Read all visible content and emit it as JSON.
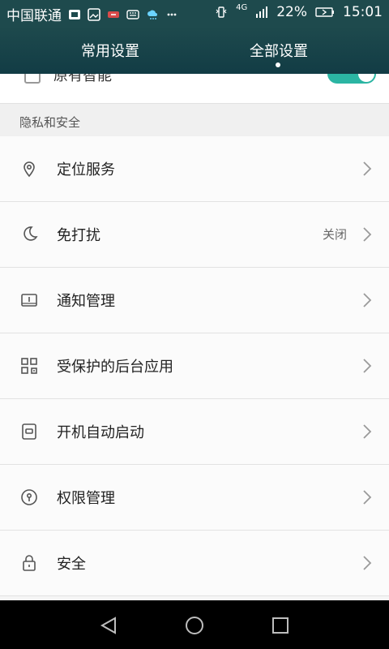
{
  "status_bar": {
    "carrier": "中国联通",
    "icons": [
      "chip-icon",
      "image-icon",
      "mobile-data-icon",
      "keyboard-icon",
      "cloud-rain-icon",
      "more-dots-icon"
    ],
    "right_icons": [
      "vibrate-icon",
      "signal-4g-icon",
      "battery-icon"
    ],
    "network": "4G",
    "battery": "22%",
    "time": "15:01"
  },
  "tabs": {
    "common": "常用设置",
    "all": "全部设置",
    "active": "all"
  },
  "partial_row": {
    "label": "原有智能",
    "toggle_on": true
  },
  "section": {
    "title": "隐私和安全"
  },
  "items": [
    {
      "label": "定位服务",
      "value": "",
      "icon": "location-pin-icon"
    },
    {
      "label": "免打扰",
      "value": "关闭",
      "icon": "moon-icon"
    },
    {
      "label": "通知管理",
      "value": "",
      "icon": "notification-box-icon"
    },
    {
      "label": "受保护的后台应用",
      "value": "",
      "icon": "protected-apps-icon"
    },
    {
      "label": "开机自动启动",
      "value": "",
      "icon": "startup-icon"
    },
    {
      "label": "权限管理",
      "value": "",
      "icon": "permission-keyhole-icon"
    },
    {
      "label": "安全",
      "value": "",
      "icon": "lock-icon"
    }
  ],
  "colors": {
    "header_bg": "#1e4a4d",
    "toggle_on": "#2bb5a3",
    "row_bg": "#fbfbfb",
    "divider": "#e2e2e2"
  }
}
